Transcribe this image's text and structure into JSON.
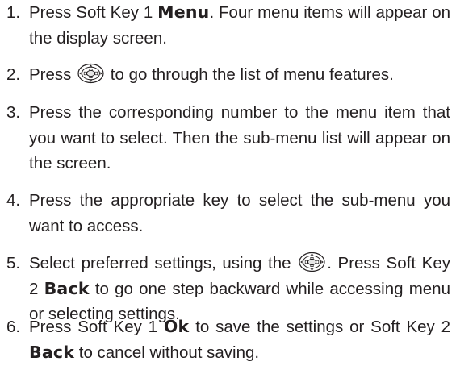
{
  "steps": [
    {
      "number": "1.",
      "before": "Press Soft Key 1 ",
      "keyword": "Menu",
      "after": ". Four menu items will appear on the display screen."
    },
    {
      "number": "2.",
      "before": "Press ",
      "icon": "navigation-key-icon",
      "after": " to go through the list of menu features."
    },
    {
      "number": "3.",
      "text": "Press the corresponding number to the menu item that you want to select. Then the sub-menu list will appear on the screen."
    },
    {
      "number": "4.",
      "text": "Press the appropriate key to select the sub-menu you want to access."
    },
    {
      "number": "5.",
      "before": "Select preferred settings, using the ",
      "icon": "navigation-key-icon",
      "middle": ". Press Soft Key 2 ",
      "keyword": "Back",
      "after": " to go one step backward while accessing menu or selecting settings."
    },
    {
      "number": "6.",
      "before": "Press Soft Key 1 ",
      "keyword": "Ok",
      "middle": " to save the settings or Soft Key 2 ",
      "keyword2": "Back",
      "after": " to cancel without saving."
    }
  ]
}
